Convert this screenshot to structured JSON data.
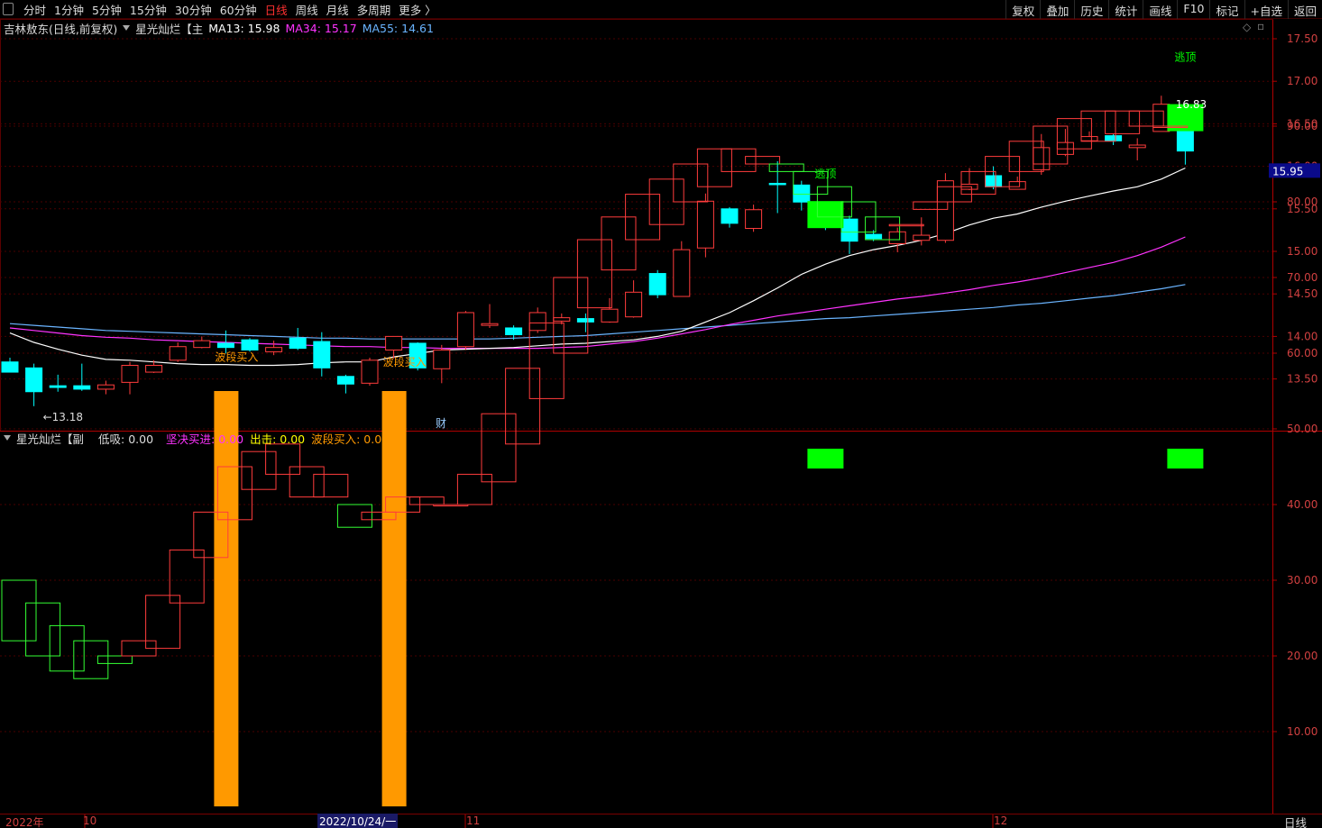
{
  "toolbar": {
    "tabs": [
      "分时",
      "1分钟",
      "5分钟",
      "15分钟",
      "30分钟",
      "60分钟",
      "日线",
      "周线",
      "月线",
      "多周期",
      "更多 〉"
    ],
    "active_tab": "日线",
    "tools": [
      "复权",
      "叠加",
      "历史",
      "统计",
      "画线",
      "F10",
      "标记",
      "+自选",
      "返回"
    ]
  },
  "main_panel": {
    "stock": "吉林敖东(日线,前复权)",
    "indicator": "星光灿烂【主",
    "ma13_label": "MA13: 15.98",
    "ma34_label": "MA34: 15.17",
    "ma55_label": "MA55: 14.61",
    "current_price": "15.95",
    "high_marker": "16.83",
    "low_marker": "←13.18",
    "finance_mark": "财",
    "signal_top": "逃顶",
    "signal_buy": "波段买入"
  },
  "sub_panel": {
    "indicator": "星光灿烂【副",
    "low_label": "低吸: 0.00",
    "firm_label": "坚决买进: 0.00",
    "exit_label": "出击: 0.00",
    "wave_label": "波段买入: 0.00"
  },
  "time_axis": {
    "labels": [
      "2022年",
      "10",
      "2022/10/24/一",
      "11",
      "12"
    ],
    "period": "日线"
  },
  "colors": {
    "up": "#ff3c3c",
    "down": "#00ffff",
    "ma13": "#ffffff",
    "ma34": "#ff33ff",
    "ma55": "#6ab4ff",
    "signal_green": "#00ff00",
    "wave_buy": "#ff9900",
    "axis_red": "#b00000"
  },
  "chart_data": [
    {
      "type": "candlestick",
      "title": "吉林敖东(日线,前复权)",
      "ylim": [
        13.2,
        17.6
      ],
      "yticks": [
        13.5,
        14.0,
        14.5,
        15.0,
        15.5,
        16.0,
        16.5,
        17.0,
        17.5
      ],
      "ytick_labels": [
        "13.50",
        "14.00",
        "14.50",
        "15.00",
        "15.50",
        "16.00",
        "16.50",
        "17.00",
        "17.50"
      ],
      "candles": [
        {
          "o": 13.7,
          "h": 13.75,
          "l": 13.58,
          "c": 13.58
        },
        {
          "o": 13.63,
          "h": 13.68,
          "l": 13.18,
          "c": 13.35
        },
        {
          "o": 13.42,
          "h": 13.55,
          "l": 13.35,
          "c": 13.4
        },
        {
          "o": 13.42,
          "h": 13.68,
          "l": 13.36,
          "c": 13.38
        },
        {
          "o": 13.38,
          "h": 13.48,
          "l": 13.32,
          "c": 13.43
        },
        {
          "o": 13.46,
          "h": 13.7,
          "l": 13.32,
          "c": 13.66
        },
        {
          "o": 13.58,
          "h": 13.72,
          "l": 13.57,
          "c": 13.66
        },
        {
          "o": 13.72,
          "h": 13.93,
          "l": 13.7,
          "c": 13.88
        },
        {
          "o": 13.87,
          "h": 14.0,
          "l": 13.86,
          "c": 13.95
        },
        {
          "o": 13.92,
          "h": 14.07,
          "l": 13.8,
          "c": 13.87
        },
        {
          "o": 13.96,
          "h": 13.98,
          "l": 13.82,
          "c": 13.84
        },
        {
          "o": 13.82,
          "h": 13.95,
          "l": 13.78,
          "c": 13.87
        },
        {
          "o": 13.98,
          "h": 14.1,
          "l": 13.84,
          "c": 13.86
        },
        {
          "o": 13.94,
          "h": 14.05,
          "l": 13.53,
          "c": 13.63
        },
        {
          "o": 13.53,
          "h": 13.55,
          "l": 13.33,
          "c": 13.44
        },
        {
          "o": 13.45,
          "h": 13.75,
          "l": 13.42,
          "c": 13.72
        },
        {
          "o": 13.84,
          "h": 14.0,
          "l": 13.74,
          "c": 14.0
        },
        {
          "o": 13.92,
          "h": 13.93,
          "l": 13.6,
          "c": 13.63
        },
        {
          "o": 13.62,
          "h": 13.9,
          "l": 13.45,
          "c": 13.84
        },
        {
          "o": 13.88,
          "h": 14.3,
          "l": 13.84,
          "c": 14.28
        },
        {
          "o": 14.13,
          "h": 14.38,
          "l": 14.1,
          "c": 14.15
        },
        {
          "o": 14.1,
          "h": 14.13,
          "l": 13.96,
          "c": 14.02
        },
        {
          "o": 14.07,
          "h": 14.34,
          "l": 14.04,
          "c": 14.28
        },
        {
          "o": 14.18,
          "h": 14.27,
          "l": 14.14,
          "c": 14.22
        },
        {
          "o": 14.21,
          "h": 14.27,
          "l": 14.05,
          "c": 14.17
        },
        {
          "o": 14.17,
          "h": 14.45,
          "l": 14.16,
          "c": 14.32
        },
        {
          "o": 14.23,
          "h": 14.66,
          "l": 14.22,
          "c": 14.52
        },
        {
          "o": 14.74,
          "h": 14.78,
          "l": 14.45,
          "c": 14.49
        },
        {
          "o": 14.47,
          "h": 15.12,
          "l": 14.47,
          "c": 15.02
        },
        {
          "o": 15.04,
          "h": 15.68,
          "l": 14.93,
          "c": 15.59
        },
        {
          "o": 15.5,
          "h": 15.52,
          "l": 15.28,
          "c": 15.33
        },
        {
          "o": 15.27,
          "h": 15.55,
          "l": 15.23,
          "c": 15.49
        },
        {
          "o": 15.8,
          "h": 16.06,
          "l": 15.45,
          "c": 15.79
        },
        {
          "o": 15.78,
          "h": 15.83,
          "l": 15.48,
          "c": 15.58
        },
        {
          "o": 15.49,
          "h": 15.57,
          "l": 15.25,
          "c": 15.35
        },
        {
          "o": 15.38,
          "h": 15.42,
          "l": 14.97,
          "c": 15.12
        },
        {
          "o": 15.2,
          "h": 15.25,
          "l": 15.12,
          "c": 15.15
        },
        {
          "o": 15.09,
          "h": 15.28,
          "l": 14.99,
          "c": 15.23
        },
        {
          "o": 15.13,
          "h": 15.4,
          "l": 15.07,
          "c": 15.19
        },
        {
          "o": 15.13,
          "h": 15.92,
          "l": 15.1,
          "c": 15.83
        },
        {
          "o": 15.73,
          "h": 15.98,
          "l": 15.72,
          "c": 15.79
        },
        {
          "o": 15.89,
          "h": 16.0,
          "l": 15.73,
          "c": 15.76
        },
        {
          "o": 15.73,
          "h": 15.88,
          "l": 15.73,
          "c": 15.82
        },
        {
          "o": 15.96,
          "h": 16.38,
          "l": 15.9,
          "c": 16.22
        },
        {
          "o": 16.14,
          "h": 16.44,
          "l": 16.12,
          "c": 16.28
        },
        {
          "o": 16.3,
          "h": 16.41,
          "l": 16.3,
          "c": 16.35
        },
        {
          "o": 16.36,
          "h": 16.38,
          "l": 16.25,
          "c": 16.3
        },
        {
          "o": 16.22,
          "h": 16.33,
          "l": 16.07,
          "c": 16.25
        },
        {
          "o": 16.41,
          "h": 16.83,
          "l": 16.41,
          "c": 16.73
        },
        {
          "o": 16.62,
          "h": 16.71,
          "l": 16.02,
          "c": 16.18
        }
      ],
      "ma13": [
        14.04,
        13.93,
        13.85,
        13.78,
        13.73,
        13.72,
        13.7,
        13.68,
        13.67,
        13.67,
        13.66,
        13.66,
        13.67,
        13.69,
        13.7,
        13.7,
        13.76,
        13.8,
        13.84,
        13.85,
        13.86,
        13.87,
        13.89,
        13.91,
        13.92,
        13.94,
        13.96,
        14.0,
        14.06,
        14.17,
        14.28,
        14.42,
        14.57,
        14.73,
        14.85,
        14.95,
        15.02,
        15.07,
        15.13,
        15.21,
        15.31,
        15.39,
        15.44,
        15.52,
        15.59,
        15.65,
        15.71,
        15.76,
        15.85,
        15.98
      ],
      "ma34": [
        14.1,
        14.07,
        14.04,
        14.01,
        13.99,
        13.98,
        13.96,
        13.95,
        13.94,
        13.93,
        13.92,
        13.91,
        13.9,
        13.89,
        13.88,
        13.88,
        13.87,
        13.87,
        13.86,
        13.86,
        13.86,
        13.86,
        13.86,
        13.87,
        13.88,
        13.91,
        13.94,
        13.98,
        14.03,
        14.08,
        14.14,
        14.19,
        14.24,
        14.28,
        14.32,
        14.36,
        14.4,
        14.44,
        14.47,
        14.51,
        14.55,
        14.6,
        14.64,
        14.69,
        14.75,
        14.81,
        14.87,
        14.95,
        15.05,
        15.17
      ],
      "ma55": [
        14.15,
        14.13,
        14.11,
        14.09,
        14.07,
        14.06,
        14.05,
        14.04,
        14.03,
        14.02,
        14.01,
        14.0,
        13.99,
        13.98,
        13.98,
        13.97,
        13.97,
        13.97,
        13.97,
        13.97,
        13.97,
        13.98,
        13.99,
        14.0,
        14.01,
        14.03,
        14.05,
        14.07,
        14.09,
        14.11,
        14.13,
        14.15,
        14.17,
        14.19,
        14.21,
        14.22,
        14.24,
        14.26,
        14.28,
        14.3,
        14.32,
        14.34,
        14.37,
        14.39,
        14.42,
        14.45,
        14.48,
        14.52,
        14.56,
        14.61
      ]
    },
    {
      "type": "bar",
      "title": "星光灿烂【副",
      "ylim": [
        0,
        98
      ],
      "yticks": [
        10,
        20,
        30,
        40,
        50,
        60,
        70,
        80,
        90
      ],
      "ytick_labels": [
        "10.00",
        "20.00",
        "30.00",
        "40.00",
        "50.00",
        "60.00",
        "70.00",
        "80.00",
        "90.00"
      ],
      "boxes": [
        {
          "o": 30.0,
          "c": 22.0
        },
        {
          "o": 27.0,
          "c": 20.0
        },
        {
          "o": 24.0,
          "c": 18.0
        },
        {
          "o": 22.0,
          "c": 17.0
        },
        {
          "o": 20.0,
          "c": 19.0
        },
        {
          "o": 20.0,
          "c": 22.0
        },
        {
          "o": 21.0,
          "c": 28.0
        },
        {
          "o": 27.0,
          "c": 34.0
        },
        {
          "o": 33.0,
          "c": 39.0
        },
        {
          "o": 38.0,
          "c": 45.0
        },
        {
          "o": 42.0,
          "c": 47.0
        },
        {
          "o": 44.0,
          "c": 48.0
        },
        {
          "o": 41.0,
          "c": 45.0
        },
        {
          "o": 41.0,
          "c": 44.0
        },
        {
          "o": 40.0,
          "c": 37.0
        },
        {
          "o": 38.0,
          "c": 39.0
        },
        {
          "o": 39.0,
          "c": 41.0
        },
        {
          "o": 40.0,
          "c": 41.0
        },
        {
          "o": 40.0,
          "c": 40.0
        },
        {
          "o": 40.0,
          "c": 44.0
        },
        {
          "o": 43.0,
          "c": 52.0
        },
        {
          "o": 48.0,
          "c": 58.0
        },
        {
          "o": 54.0,
          "c": 64.0
        },
        {
          "o": 60.0,
          "c": 70.0
        },
        {
          "o": 66.0,
          "c": 75.0
        },
        {
          "o": 71.0,
          "c": 78.0
        },
        {
          "o": 75.0,
          "c": 81.0
        },
        {
          "o": 77.0,
          "c": 83.0
        },
        {
          "o": 80.0,
          "c": 85.0
        },
        {
          "o": 82.0,
          "c": 87.0
        },
        {
          "o": 84.0,
          "c": 87.0
        },
        {
          "o": 85.0,
          "c": 86.0
        },
        {
          "o": 85.0,
          "c": 84.0
        },
        {
          "o": 84.0,
          "c": 81.0
        },
        {
          "o": 82.0,
          "c": 78.0
        },
        {
          "o": 80.0,
          "c": 76.0
        },
        {
          "o": 78.0,
          "c": 75.0
        },
        {
          "o": 77.0,
          "c": 77.0
        },
        {
          "o": 79.0,
          "c": 80.0
        },
        {
          "o": 80.0,
          "c": 82.0
        },
        {
          "o": 81.0,
          "c": 84.0
        },
        {
          "o": 82.0,
          "c": 86.0
        },
        {
          "o": 84.0,
          "c": 88.0
        },
        {
          "o": 85.0,
          "c": 90.0
        },
        {
          "o": 87.0,
          "c": 91.0
        },
        {
          "o": 88.0,
          "c": 92.0
        },
        {
          "o": 89.0,
          "c": 92.0
        },
        {
          "o": 90.0,
          "c": 92.0
        },
        {
          "o": 90.0,
          "c": 90.0
        }
      ],
      "wave_buy_bars": [
        {
          "index": 9,
          "value": 55
        },
        {
          "index": 16,
          "value": 55
        }
      ],
      "top_signal_bars": [
        {
          "index": 34
        },
        {
          "index": 49
        }
      ]
    }
  ]
}
